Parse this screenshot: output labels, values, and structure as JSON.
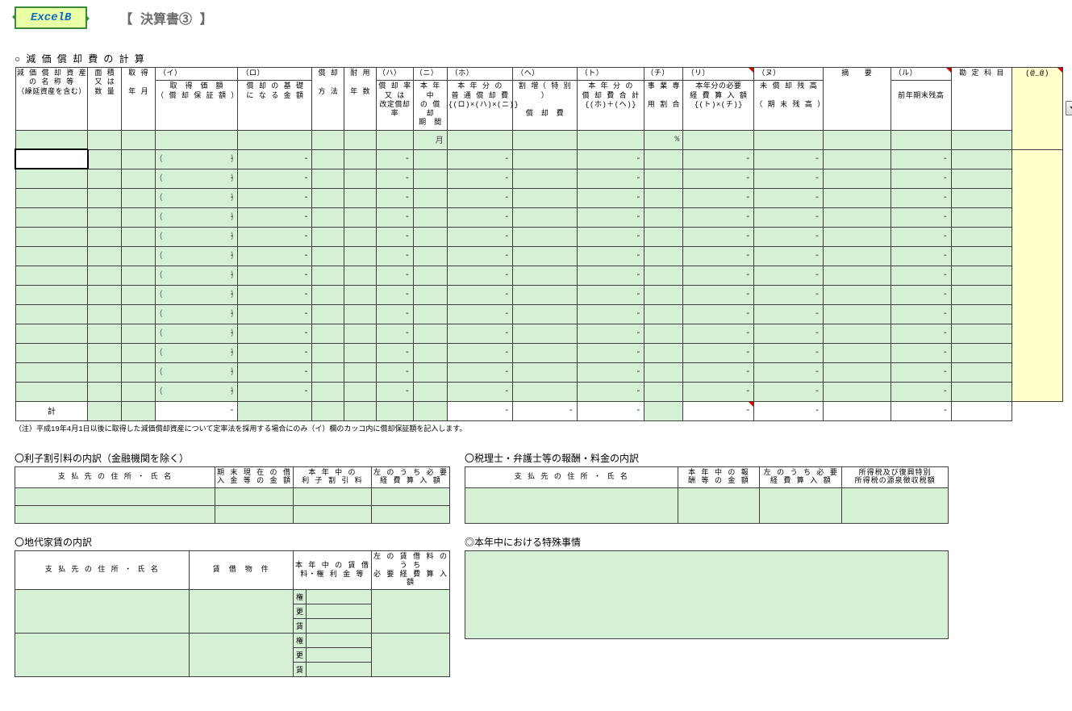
{
  "app": {
    "badge": "ExcelB",
    "title": "【 決算書③ 】"
  },
  "section1": {
    "title": "○ 減 価 償 却 費 の 計 算",
    "headers": {
      "c1_l1": "減 価 償 却 資 産",
      "c1_l2": "の 名 称 等",
      "c1_l3": "（繰延資産を含む）",
      "c2_l1": "面 積",
      "c2_l2": "又 は",
      "c2_l3": "数 量",
      "c3_l1": "取 得",
      "c3_l2": "年 月",
      "c4_k": "（イ）",
      "c4_l1": "取　得　価　額",
      "c4_l2": "（ 償 却 保 証 額 ）",
      "c5_k": "（ロ）",
      "c5_l1": "償 却 の 基 礎",
      "c5_l2": "に な る 金 額",
      "c6_l1": "償 却",
      "c6_l2": "方 法",
      "c7_l1": "耐 用",
      "c7_l2": "年 数",
      "c8_k": "（ハ）",
      "c8_l1": "償 却 率",
      "c8_l2": "又 は",
      "c8_l3": "改定償却率",
      "c9_k": "（ニ）",
      "c9_l1": "本 年 中",
      "c9_l2": "の 償 却",
      "c9_l3": "期　間",
      "c10_k": "（ホ）",
      "c10_l1": "本 年 分 の",
      "c10_l2": "普 通 償 却 費",
      "c10_l3": "{(ロ)×(ハ)×(ニ)}",
      "c11_k": "（ヘ）",
      "c11_l1": "割 増（ 特 別 ）",
      "c11_l2": "償　却　費",
      "c12_k": "（ト）",
      "c12_l1": "本 年 分 の",
      "c12_l2": "償 却 費 合 計",
      "c12_l3": "{(ホ)＋(ヘ)}",
      "c13_k": "（チ）",
      "c13_l1": "事 業 専",
      "c13_l2": "用 割 合",
      "c14_k": "（リ）",
      "c14_l1": "本年分の必要",
      "c14_l2": "経 費 算 入 額",
      "c14_l3": "{(ト)×(チ)}",
      "c15_k": "（ヌ）",
      "c15_l1": "未 償 却 残 高",
      "c15_l2": "（ 期 末 残 高 ）",
      "c16": "摘　　要",
      "c17_k": "（ル）",
      "c17_l1": "前年期末残高",
      "c18": "勘 定 科 目",
      "c19": "(@_@)"
    },
    "month_label": "月",
    "dash": "-",
    "pct": "%",
    "total_label": "計",
    "footnote": "（注）平成19年4月1日以後に取得した減価償却資産について定率法を採用する場合にのみ（イ）欄のカッコ内に償却保証額を記入します。"
  },
  "section2": {
    "title": "〇利子割引料の内訳（金融機関を除く）",
    "h1": "支 払 先 の 住 所 ・ 氏 名",
    "h2_l1": "期 末 現 在 の 借",
    "h2_l2": "入 金 等 の 金 額",
    "h3_l1": "本 年 中 の",
    "h3_l2": "利 子 割 引 料",
    "h4_l1": "左 の う ち 必 要",
    "h4_l2": "経 費 算 入 額"
  },
  "section3": {
    "title": "〇税理士・弁護士等の報酬・料金の内訳",
    "h1": "支 払 先 の 住 所 ・ 氏 名",
    "h2_l1": "本 年 中 の 報",
    "h2_l2": "酬 等 の 金 額",
    "h3_l1": "左 の う ち 必 要",
    "h3_l2": "経 費 算 入 額",
    "h4_l1": "所得税及び復興特別",
    "h4_l2": "所得税の源泉徴収税額"
  },
  "section4": {
    "title": "〇地代家賃の内訳",
    "h1": "支 払 先 の 住 所 ・ 氏 名",
    "h2": "賃　借　物　件",
    "h3_l1": "本 年 中 の 賃 借",
    "h3_l2": "料・権 利 金 等",
    "h4_l1": "左 の 賃 借 料 の う ち",
    "h4_l2": "必 要 経 費 算 入 額",
    "row_labels": [
      "権",
      "更",
      "賃",
      "権",
      "更",
      "賃"
    ]
  },
  "section5": {
    "title": "◎本年中における特殊事情"
  }
}
